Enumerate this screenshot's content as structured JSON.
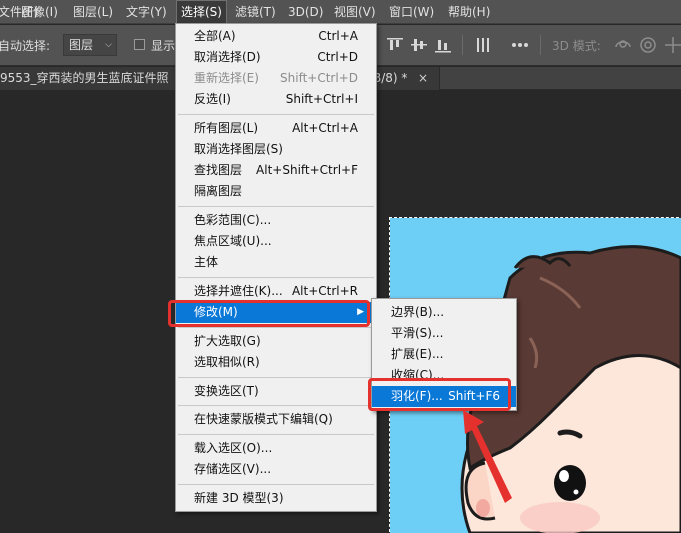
{
  "menubar": {
    "items": [
      {
        "label": "文件(F)"
      },
      {
        "label": "图像(I)"
      },
      {
        "label": "图层(L)"
      },
      {
        "label": "文字(Y)"
      },
      {
        "label": "选择(S)"
      },
      {
        "label": "滤镜(T)"
      },
      {
        "label": "3D(D)"
      },
      {
        "label": "视图(V)"
      },
      {
        "label": "窗口(W)"
      },
      {
        "label": "帮助(H)"
      }
    ]
  },
  "options": {
    "auto_select_label": "自动选择:",
    "layer_select_value": "图层",
    "show_label": "显示",
    "mode_3d_label": "3D 模式:"
  },
  "document_tab": {
    "title_left": "9553_穿西装的男生蓝底证件照",
    "title_right": "B/8) *",
    "close": "×"
  },
  "select_menu": {
    "groups": [
      [
        {
          "label": "全部(A)",
          "shortcut": "Ctrl+A"
        },
        {
          "label": "取消选择(D)",
          "shortcut": "Ctrl+D"
        },
        {
          "label": "重新选择(E)",
          "shortcut": "Shift+Ctrl+D",
          "disabled": true
        },
        {
          "label": "反选(I)",
          "shortcut": "Shift+Ctrl+I"
        }
      ],
      [
        {
          "label": "所有图层(L)",
          "shortcut": "Alt+Ctrl+A"
        },
        {
          "label": "取消选择图层(S)",
          "shortcut": ""
        },
        {
          "label": "查找图层",
          "shortcut": "Alt+Shift+Ctrl+F"
        },
        {
          "label": "隔离图层",
          "shortcut": ""
        }
      ],
      [
        {
          "label": "色彩范围(C)...",
          "shortcut": ""
        },
        {
          "label": "焦点区域(U)...",
          "shortcut": ""
        },
        {
          "label": "主体",
          "shortcut": ""
        }
      ],
      [
        {
          "label": "选择并遮住(K)...",
          "shortcut": "Alt+Ctrl+R"
        },
        {
          "label": "修改(M)",
          "shortcut": "",
          "highlighted": true,
          "submenu": true
        }
      ],
      [
        {
          "label": "扩大选取(G)",
          "shortcut": ""
        },
        {
          "label": "选取相似(R)",
          "shortcut": ""
        }
      ],
      [
        {
          "label": "变换选区(T)",
          "shortcut": ""
        }
      ],
      [
        {
          "label": "在快速蒙版模式下编辑(Q)",
          "shortcut": ""
        }
      ],
      [
        {
          "label": "载入选区(O)...",
          "shortcut": ""
        },
        {
          "label": "存储选区(V)...",
          "shortcut": ""
        }
      ],
      [
        {
          "label": "新建 3D 模型(3)",
          "shortcut": ""
        }
      ]
    ]
  },
  "modify_submenu": {
    "items": [
      {
        "label": "边界(B)...",
        "shortcut": ""
      },
      {
        "label": "平滑(S)...",
        "shortcut": ""
      },
      {
        "label": "扩展(E)...",
        "shortcut": ""
      },
      {
        "label": "收缩(C)...",
        "shortcut": ""
      },
      {
        "label": "羽化(F)...",
        "shortcut": "Shift+F6",
        "highlighted": true
      }
    ]
  },
  "colors": {
    "menu_highlight": "#0a78d7",
    "annotation_red": "#e5312e",
    "canvas_blue": "#6ecff6"
  }
}
